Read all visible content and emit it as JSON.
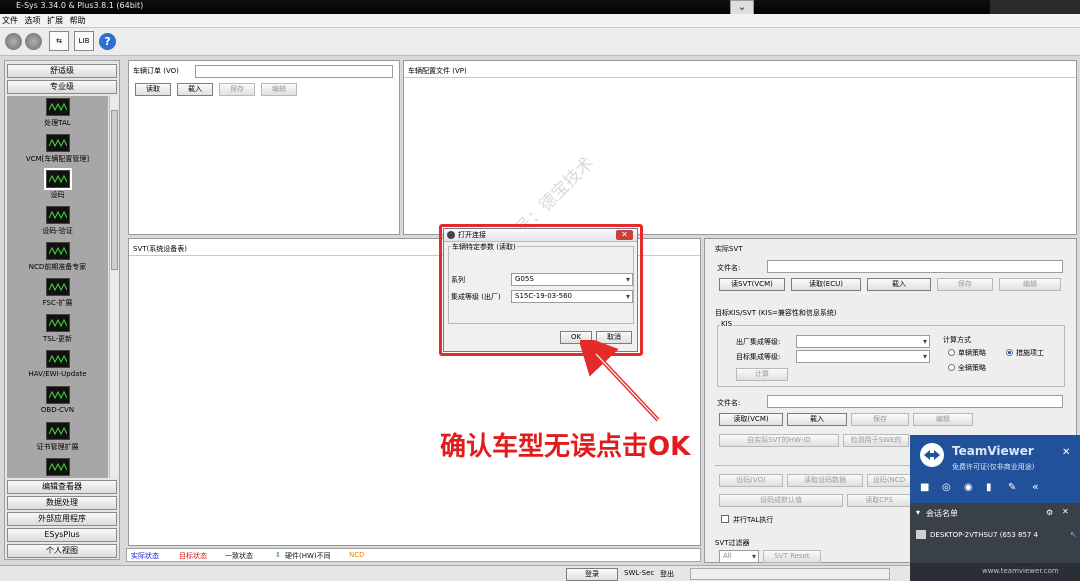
{
  "window": {
    "title": "E-Sys 3.34.0 & Plus3.8.1 (64bit)"
  },
  "menu": [
    "文件",
    "选项",
    "扩展",
    "帮助"
  ],
  "toolbar": {
    "lib_label": "LIB"
  },
  "sidebar": {
    "top_buttons": [
      "舒适级",
      "专业级"
    ],
    "modules": [
      "处理TAL",
      "VCM[车辆配置管理]",
      "设码",
      "设码-验证",
      "NCD前期准备专家",
      "FSC-扩展",
      "TSL-更新",
      "HAV/EWI-Update",
      "OBD-CVN",
      "证书管理扩展"
    ],
    "bottom_buttons": [
      "编辑查看器",
      "数据处理",
      "外部应用程序",
      "ESysPlus",
      "个人视图"
    ]
  },
  "vo_panel": {
    "label": "车辆订单 (VO)",
    "buttons": [
      "读取",
      "载入",
      "保存",
      "编辑"
    ]
  },
  "vp_panel": {
    "label": "车辆配置文件 (VP)"
  },
  "svt_panel": {
    "label": "SVT(系统设备表)"
  },
  "right_panel": {
    "actual_svt": {
      "label": "实际SVT",
      "filename_label": "文件名:",
      "buttons": [
        "读SVT(VCM)",
        "读取(ECU)",
        "载入",
        "保存",
        "编辑"
      ]
    },
    "target_kis": {
      "label": "目标KIS/SVT (KIS=兼容性和信息系统)",
      "kis_label": "KIS",
      "factory_level_label": "出厂集成等级:",
      "target_level_label": "目标集成等级:",
      "calc_button": "计算",
      "calc_method_label": "计算方式",
      "options": [
        "单辆策略",
        "措施项工",
        "全辆策略"
      ],
      "selected_option": "措施项工",
      "filename_label": "文件名:",
      "buttons": [
        "读取(VCM)",
        "载入",
        "保存",
        "编辑"
      ],
      "button_row2": [
        "自实际SVT的HW-ID",
        "检测用于SWE的"
      ]
    },
    "coding": {
      "buttons_row1": [
        "设码(VO)",
        "读取设码数据",
        "设码(NCD"
      ],
      "buttons_row2": [
        "设码成默认值",
        "读取CPS"
      ],
      "parallel_tal_label": "并行TAL执行"
    },
    "svt_filter": {
      "label": "SVT过滤器",
      "select_value": "All",
      "reset_button": "SVT Reset"
    }
  },
  "statusbar": {
    "items": [
      {
        "text": "实际状态",
        "color": "#1515d8"
      },
      {
        "text": "目标状态",
        "color": "#d81515"
      },
      {
        "text": "一致状态",
        "color": "#111111"
      },
      {
        "text": "硬件(HW)不同",
        "color": "#111111"
      },
      {
        "text": "NCD",
        "color": "#e38a00"
      }
    ]
  },
  "bottombar": {
    "login_button": "登录",
    "swl_label": "SWL-Sec",
    "logout_label": "登出"
  },
  "dialog": {
    "title": "打开连接",
    "group_label": "车辆特定参数 (读取)",
    "series_label": "系列",
    "series_value": "G05S",
    "level_label": "集成等级 (出厂)",
    "level_value": "S15C-19-03-560",
    "ok_button": "OK",
    "cancel_button": "取消"
  },
  "annotation": {
    "text": "确认车型无误点击OK"
  },
  "watermark": {
    "text": "微信公众号：德宝技术"
  },
  "teamviewer": {
    "title": "TeamViewer",
    "subtitle": "免费许可证(仅非商业用途)",
    "sessions_label": "会话名单",
    "session_item": "DESKTOP-2VTHSU7 (653 857 4",
    "footer_url": "www.teamviewer.com"
  }
}
